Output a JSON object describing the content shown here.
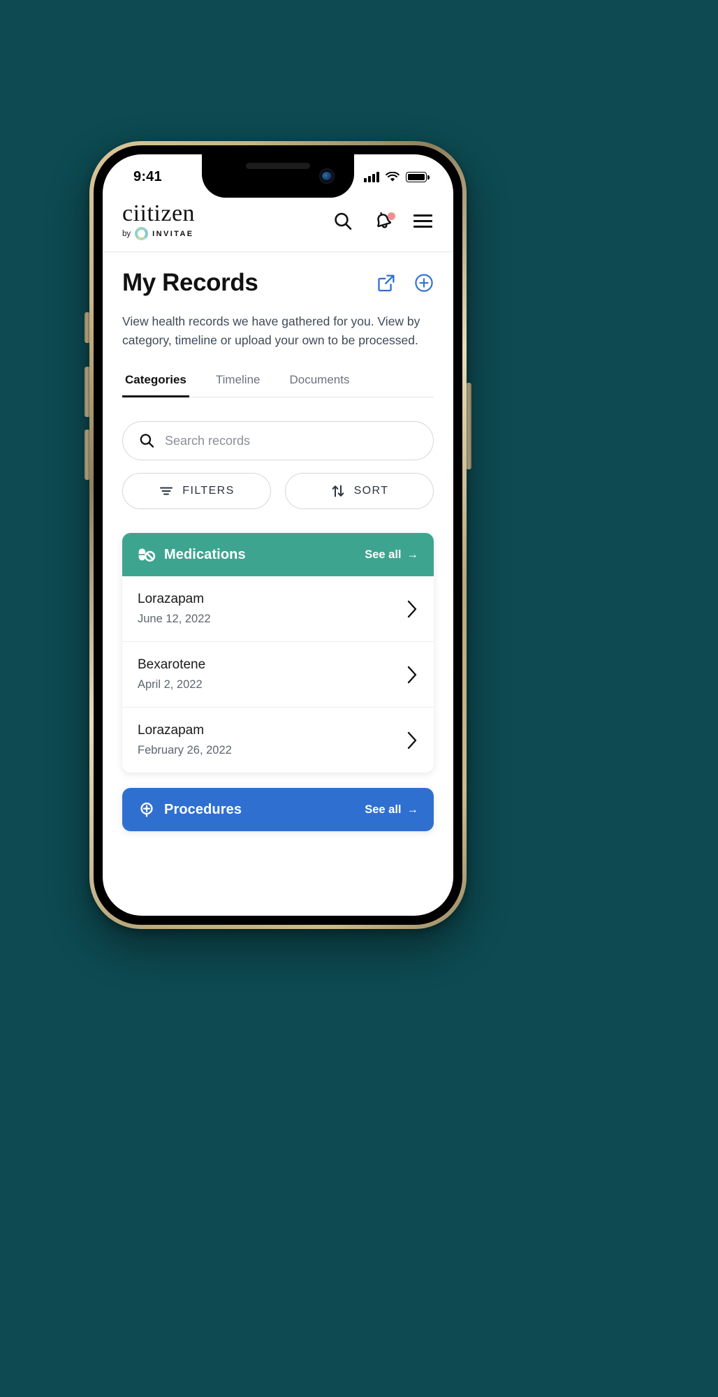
{
  "theme": {
    "background": "#0d4a51",
    "accent_blue": "#2f6fd0",
    "medications_teal": "#3da58f",
    "procedures_blue": "#2f6fd0",
    "notification_dot": "#ef8f8f"
  },
  "status_bar": {
    "time": "9:41",
    "signal_icon": "cellular-signal-icon",
    "wifi_icon": "wifi-icon",
    "battery_icon": "battery-full-icon"
  },
  "header": {
    "logo_word": "ciitizen",
    "logo_by": "by",
    "logo_brand": "INVITAE",
    "search_icon": "search-icon",
    "notifications_icon": "bell-icon",
    "menu_icon": "hamburger-menu-icon"
  },
  "page": {
    "title": "My Records",
    "share_icon": "external-link-icon",
    "add_icon": "plus-circle-icon",
    "description": "View health records we have gathered for you. View by category, timeline or upload your own to be processed."
  },
  "tabs": [
    {
      "label": "Categories",
      "active": true
    },
    {
      "label": "Timeline",
      "active": false
    },
    {
      "label": "Documents",
      "active": false
    }
  ],
  "search": {
    "placeholder": "Search records",
    "value": "",
    "icon": "search-icon"
  },
  "tools": [
    {
      "label": "FILTERS",
      "icon": "filter-lines-icon"
    },
    {
      "label": "SORT",
      "icon": "sort-arrows-icon"
    }
  ],
  "cards": [
    {
      "title": "Medications",
      "icon": "pill-no-entry-icon",
      "color": "#3da58f",
      "see_all_label": "See all",
      "see_all_arrow": "→",
      "rows": [
        {
          "name": "Lorazapam",
          "date": "June 12, 2022"
        },
        {
          "name": "Bexarotene",
          "date": "April 2, 2022"
        },
        {
          "name": "Lorazapam",
          "date": "February 26, 2022"
        }
      ]
    },
    {
      "title": "Procedures",
      "icon": "procedure-plus-icon",
      "color": "#2f6fd0",
      "see_all_label": "See all",
      "see_all_arrow": "→",
      "rows": []
    }
  ]
}
